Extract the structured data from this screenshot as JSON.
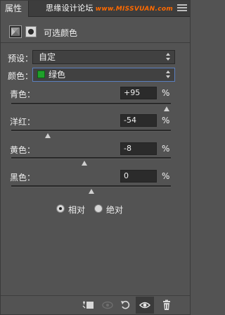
{
  "panel": {
    "tab_label": "属性",
    "watermark": "思缘设计论坛",
    "watermark_site": "www.MISSVUAN.com"
  },
  "header": {
    "title": "可选颜色"
  },
  "preset": {
    "label": "预设：",
    "value": "自定"
  },
  "colors": {
    "label": "颜色：",
    "value": "绿色",
    "swatch_color": "#1fa12a"
  },
  "sliders": [
    {
      "label": "青色：",
      "value": "+95",
      "percent": "%",
      "level": 95
    },
    {
      "label": "洋红：",
      "value": "-54",
      "percent": "%",
      "level": -54
    },
    {
      "label": "黄色：",
      "value": "-8",
      "percent": "%",
      "level": -8
    },
    {
      "label": "黑色：",
      "value": "0",
      "percent": "%",
      "level": 0
    }
  ],
  "method": {
    "options": [
      "相对",
      "绝对"
    ],
    "selected": "相对"
  },
  "bottom_icons": [
    "clip-to-layer-icon",
    "view-previous-icon",
    "reset-icon",
    "visibility-icon",
    "delete-icon"
  ]
}
